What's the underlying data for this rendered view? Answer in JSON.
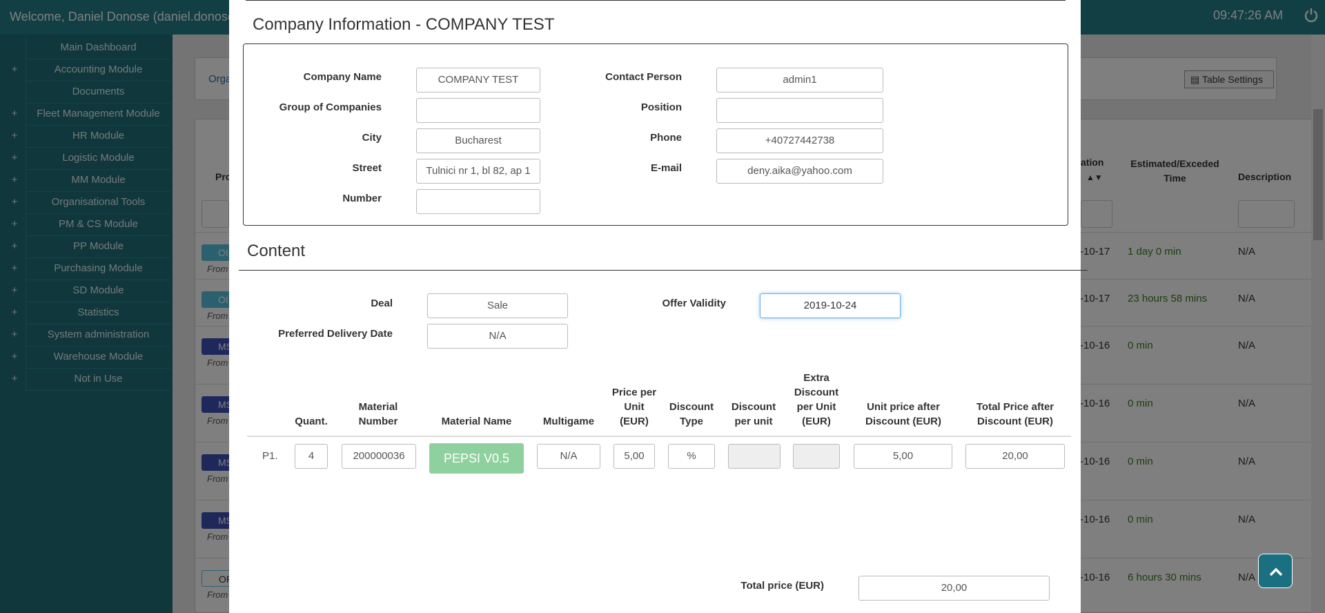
{
  "topbar": {
    "welcome": "Welcome, Daniel Donose (daniel.donose",
    "clock": "09:47:26 AM"
  },
  "sidebar": {
    "items": [
      {
        "label": "Main Dashboard",
        "expandable": false
      },
      {
        "label": "Accounting Module",
        "expandable": true
      },
      {
        "label": "Documents",
        "expandable": false
      },
      {
        "label": "Fleet Management Module",
        "expandable": true
      },
      {
        "label": "HR Module",
        "expandable": true
      },
      {
        "label": "Logistic Module",
        "expandable": true
      },
      {
        "label": "MM Module",
        "expandable": true
      },
      {
        "label": "Organisational Tools",
        "expandable": true
      },
      {
        "label": "PM & CS Module",
        "expandable": true
      },
      {
        "label": "PP Module",
        "expandable": true
      },
      {
        "label": "Purchasing Module",
        "expandable": true
      },
      {
        "label": "SD Module",
        "expandable": true
      },
      {
        "label": "Statistics",
        "expandable": true
      },
      {
        "label": "System administration",
        "expandable": true
      },
      {
        "label": "Warehouse Module",
        "expandable": true
      },
      {
        "label": "Not in Use",
        "expandable": true
      }
    ],
    "plus_glyph": "+"
  },
  "background": {
    "orga": "Orga",
    "table_settings": "Table Settings",
    "col_pro": "Pro",
    "col_ation": "ation",
    "col_estimated": "Estimated/Exceded Time",
    "col_description": "Description",
    "rows": [
      {
        "badge": "OI",
        "badge_color": "#5bc0de",
        "from": "From",
        "date": "-10-17",
        "time": "1 day 0 min",
        "desc": "N/A"
      },
      {
        "badge": "OI",
        "badge_color": "#5bc0de",
        "from": "From",
        "date": "-10-17",
        "time": "23 hours 58 mins",
        "desc": "N/A"
      },
      {
        "badge": "MS",
        "badge_color": "#3f51b5",
        "from": "From",
        "date": "-10-16",
        "time": "0 min",
        "desc": "N/A"
      },
      {
        "badge": "MS",
        "badge_color": "#3f51b5",
        "from": "From",
        "date": "-10-16",
        "time": "0 min",
        "desc": "N/A"
      },
      {
        "badge": "MS",
        "badge_color": "#3f51b5",
        "from": "From",
        "date": "-10-16",
        "time": "0 min",
        "desc": "N/A"
      },
      {
        "badge": "MS",
        "badge_color": "#3f51b5",
        "from": "From",
        "date": "-10-16",
        "time": "0 min",
        "desc": "N/A"
      },
      {
        "badge": "OF",
        "badge_color": "#ffffff",
        "from": "From",
        "date": "-10-16",
        "time": "6 hours 30 mins",
        "desc": "N/A"
      }
    ]
  },
  "modal": {
    "company_title": "Company Information - COMPANY TEST",
    "company": {
      "company_name_label": "Company Name",
      "company_name": "COMPANY TEST",
      "group_label": "Group of Companies",
      "group": "",
      "city_label": "City",
      "city": "Bucharest",
      "street_label": "Street",
      "street": "Tulnici nr 1, bl 82, ap 1",
      "number_label": "Number",
      "number": "",
      "contact_label": "Contact Person",
      "contact": "admin1",
      "position_label": "Position",
      "position": "",
      "phone_label": "Phone",
      "phone": "+40727442738",
      "email_label": "E-mail",
      "email": "deny.aika@yahoo.com"
    },
    "content_title": "Content",
    "deal_label": "Deal",
    "deal": "Sale",
    "delivery_label": "Preferred Delivery Date",
    "delivery": "N/A",
    "validity_label": "Offer Validity",
    "validity": "2019-10-24",
    "table": {
      "headers": {
        "quant": "Quant.",
        "material_number": "Material Number",
        "material_name": "Material Name",
        "multigame": "Multigame",
        "price_per_unit": "Price per Unit (EUR)",
        "discount_type": "Discount Type",
        "discount_per_unit": "Discount per unit",
        "extra_discount": "Extra Discount per Unit (EUR)",
        "unit_price_after": "Unit price after Discount (EUR)",
        "total_price_after": "Total Price after Discount (EUR)"
      },
      "row": {
        "label": "P1.",
        "quant": "4",
        "material_number": "200000036",
        "material_name": "PEPSI V0.5",
        "multigame": "N/A",
        "price_per_unit": "5,00",
        "discount_type": "%",
        "discount_per_unit": "",
        "extra_discount": "",
        "unit_price_after": "5,00",
        "total_price_after": "20,00"
      }
    },
    "total_label": "Total price (EUR)",
    "total": "20,00"
  },
  "colors": {
    "brand": "#237f86",
    "sidebar": "#1f6f78",
    "material_button": "#8fd19e",
    "scroll_button": "#1a7080"
  }
}
